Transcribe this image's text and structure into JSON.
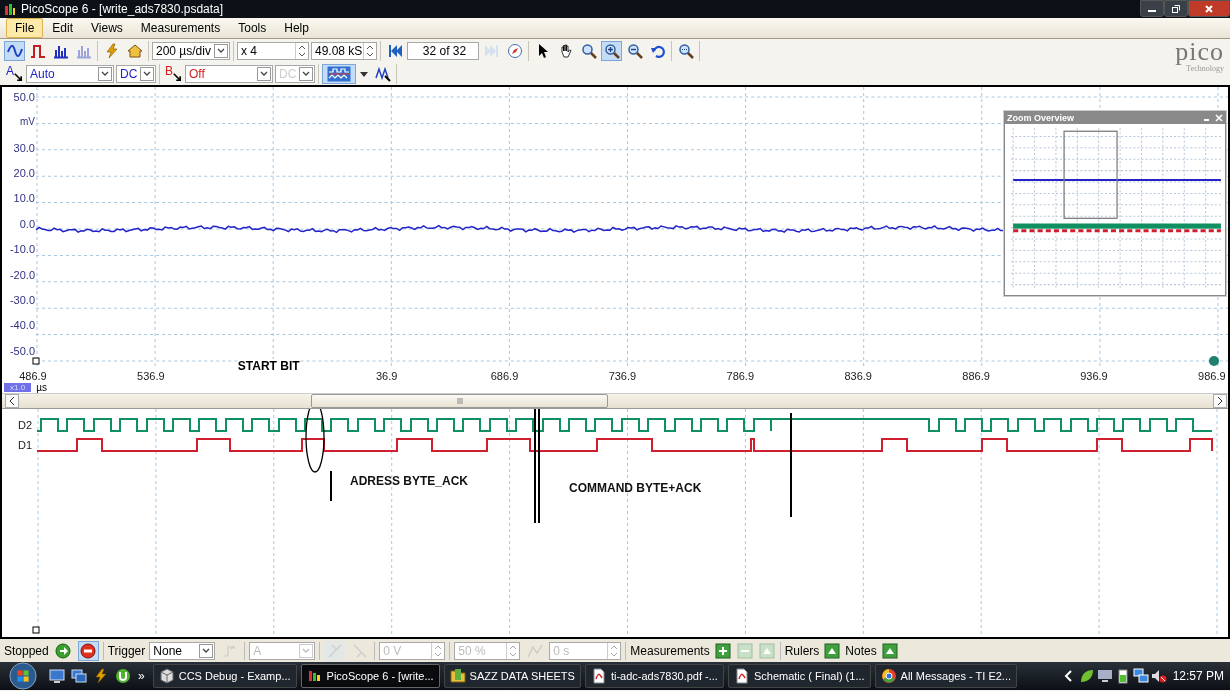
{
  "window": {
    "title": "PicoScope 6 - [write_ads7830.psdata]"
  },
  "menu": [
    {
      "label": "File",
      "selected": true
    },
    {
      "label": "Edit",
      "selected": false
    },
    {
      "label": "Views",
      "selected": false
    },
    {
      "label": "Measurements",
      "selected": false
    },
    {
      "label": "Tools",
      "selected": false
    },
    {
      "label": "Help",
      "selected": false
    }
  ],
  "toolbar": {
    "view_modes": [
      {
        "selected": true,
        "disabled": false
      },
      {
        "selected": false,
        "disabled": false
      },
      {
        "selected": false,
        "disabled": false
      },
      {
        "selected": false,
        "disabled": true
      }
    ],
    "timebase": "200 µs/div",
    "zoom": "x 4",
    "samples": "49.08 kS",
    "buffer": "32 of 32",
    "tools": [
      {
        "selected": false
      },
      {
        "selected": false
      },
      {
        "selected": false
      },
      {
        "selected": true
      },
      {
        "selected": false
      },
      {
        "selected": false
      }
    ],
    "logo": {
      "name": "pico",
      "tagline": "Technology"
    }
  },
  "channels": [
    {
      "label": "A",
      "range": "Auto",
      "coupling": "DC",
      "coupling_disabled": false,
      "color": "#2323c8"
    },
    {
      "label": "B",
      "range": "Off",
      "coupling": "DC",
      "coupling_disabled": true,
      "color": "#d02020"
    }
  ],
  "scope": {
    "y_axis": [
      {
        "kind": "tick",
        "text": "50.0"
      },
      {
        "kind": "unit",
        "text": "mV"
      },
      {
        "kind": "tick",
        "text": "30.0"
      },
      {
        "kind": "tick",
        "text": "20.0"
      },
      {
        "kind": "tick",
        "text": "10.0"
      },
      {
        "kind": "tick",
        "text": "0.0"
      },
      {
        "kind": "tick",
        "text": "-10.0"
      },
      {
        "kind": "tick",
        "text": "-20.0"
      },
      {
        "kind": "tick",
        "text": "-30.0"
      },
      {
        "kind": "tick",
        "text": "-40.0"
      },
      {
        "kind": "tick",
        "text": "-50.0"
      }
    ],
    "x_axis": [
      {
        "kind": "tick",
        "text": "486.9"
      },
      {
        "kind": "tick",
        "text": "536.9"
      },
      {
        "kind": "note",
        "text": "START BIT"
      },
      {
        "kind": "tick",
        "text": "36.9"
      },
      {
        "kind": "tick",
        "text": "686.9"
      },
      {
        "kind": "tick",
        "text": "736.9"
      },
      {
        "kind": "tick",
        "text": "786.9"
      },
      {
        "kind": "tick",
        "text": "836.9"
      },
      {
        "kind": "tick",
        "text": "886.9"
      },
      {
        "kind": "tick",
        "text": "936.9"
      },
      {
        "kind": "tick",
        "text": "986.9"
      }
    ],
    "x_unit": "µs",
    "x_scale": "x1.0",
    "digital_channels": [
      {
        "label": "D2",
        "color": "#109060"
      },
      {
        "label": "D1",
        "color": "#d02030"
      }
    ],
    "annotations": [
      "ADRESS BYTE_ACK",
      "COMMAND BYTE+ACK"
    ],
    "zoom_overview": {
      "title": "Zoom Overview"
    }
  },
  "status_bar": {
    "state": "Stopped",
    "trigger_label": "Trigger",
    "trigger_mode": "None",
    "trigger_source": "A",
    "threshold": "0 V",
    "pre_trigger": "50 %",
    "delay": "0 s",
    "measurements": "Measurements",
    "rulers": "Rulers",
    "notes": "Notes"
  },
  "taskbar": {
    "more": "»",
    "tasks": [
      {
        "label": "CCS Debug - Examp...",
        "selected": false
      },
      {
        "label": "PicoScope 6 - [write...",
        "selected": true
      },
      {
        "label": "SAZZ DATA SHEETS",
        "selected": false
      },
      {
        "label": "ti-adc-ads7830.pdf -...",
        "selected": false
      },
      {
        "label": "Schematic ( Final) (1...",
        "selected": false
      },
      {
        "label": "All Messages - TI E2...",
        "selected": false
      }
    ],
    "clock": "12:57 PM"
  }
}
